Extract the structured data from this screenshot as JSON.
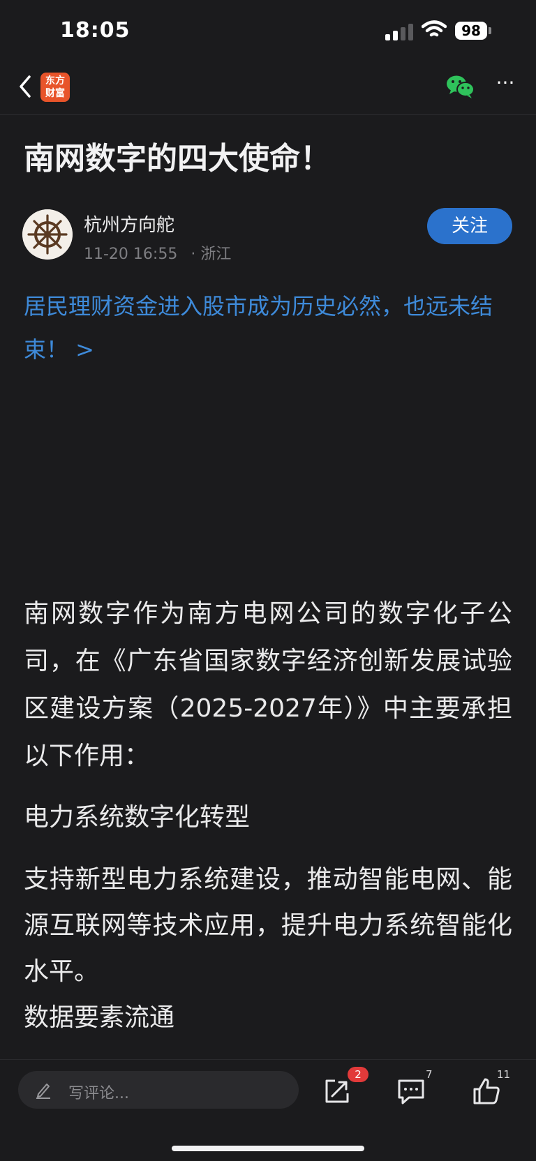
{
  "status": {
    "time": "18:05",
    "battery": "98"
  },
  "nav": {
    "logo_line1": "东方",
    "logo_line2": "财富",
    "more": "···"
  },
  "article": {
    "title": "南网数字的四大使命！",
    "author": "杭州方向舵",
    "datetime": "11-20 16:55",
    "location": "· 浙江",
    "follow_label": "关注",
    "related_link": "居民理财资金进入股市成为历史必然，也远未结束！ >",
    "paragraph1": "南网数字作为南方电网公司的数字化子公司，在《广东省国家数字经济创新发展试验区建设方案（2025-2027年）》中主要承担以下作用：",
    "heading1": "电力系统数字化转型",
    "paragraph2": "支持新型电力系统建设，推动智能电网、能源互联网等技术应用，提升电力系统智能化水平。",
    "heading2": "数据要素流通"
  },
  "bottom_bar": {
    "comment_placeholder": "写评论...",
    "share_badge": "2",
    "comment_count": "7",
    "like_count": "11"
  },
  "colors": {
    "background": "#1b1b1d",
    "accent_blue": "#2b72cc",
    "link_blue": "#3e8ad9",
    "brand_orange": "#e8542a",
    "badge_red": "#e23a3a",
    "wechat_green": "#2fc25b"
  },
  "icons": [
    "back-chevron-icon",
    "wechat-icon",
    "more-icon",
    "pen-icon",
    "share-icon",
    "comment-icon",
    "like-icon"
  ]
}
